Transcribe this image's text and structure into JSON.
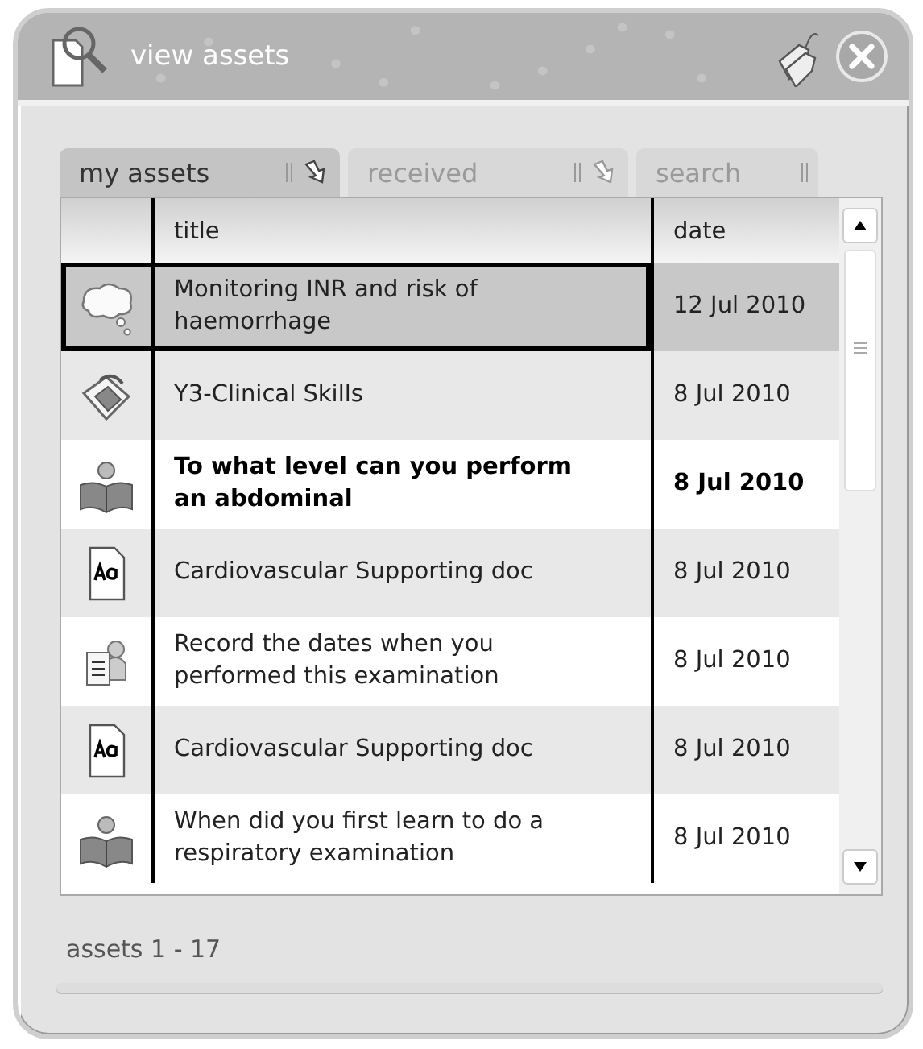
{
  "window": {
    "title": "view assets"
  },
  "tabs": [
    {
      "label": "my assets",
      "selected": true,
      "arrow": true
    },
    {
      "label": "received",
      "selected": false,
      "arrow": true
    },
    {
      "label": "search",
      "selected": false,
      "arrow": false
    }
  ],
  "table": {
    "columns": [
      "title",
      "date"
    ],
    "rows": [
      {
        "kind": "thought",
        "title": "Monitoring INR and risk of haemorrhage",
        "date": "12 Jul 2010",
        "selected": true,
        "unread": false
      },
      {
        "kind": "cycle",
        "title": "Y3-Clinical Skills",
        "date": "8 Jul 2010",
        "selected": false,
        "unread": false
      },
      {
        "kind": "reader",
        "title": "To what level can you perform an abdominal",
        "date": "8 Jul 2010",
        "selected": false,
        "unread": true
      },
      {
        "kind": "document",
        "title": "Cardiovascular Supporting doc",
        "date": "8 Jul 2010",
        "selected": false,
        "unread": false
      },
      {
        "kind": "report",
        "title": "Record the dates when you performed this examination",
        "date": "8 Jul 2010",
        "selected": false,
        "unread": false
      },
      {
        "kind": "document",
        "title": "Cardiovascular Supporting doc",
        "date": "8 Jul 2010",
        "selected": false,
        "unread": false
      },
      {
        "kind": "reader",
        "title": "When did you first learn to do a respiratory examination",
        "date": "8 Jul 2010",
        "selected": false,
        "unread": false
      }
    ]
  },
  "status_bar": "assets 1 - 17"
}
